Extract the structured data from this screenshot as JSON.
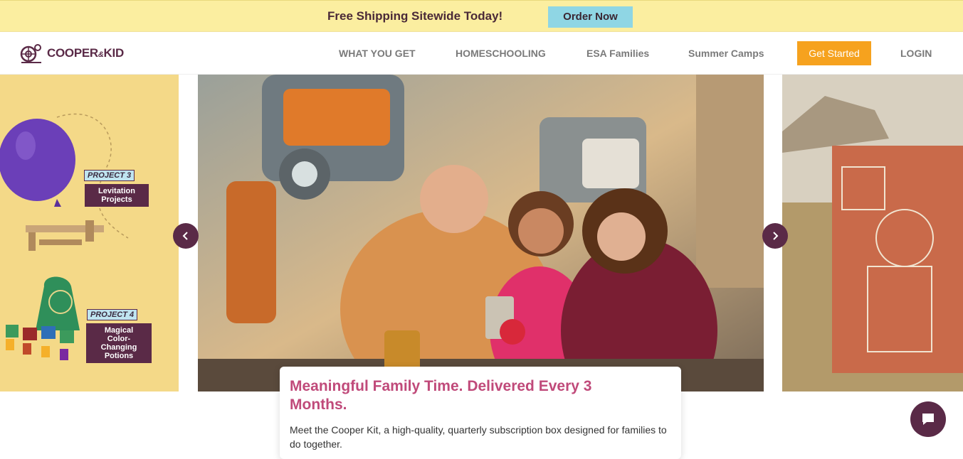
{
  "promo": {
    "text": "Free Shipping Sitewide Today!",
    "button": "Order Now"
  },
  "header": {
    "logo_text": "COOPER",
    "logo_amp": "&",
    "logo_text2": "KID",
    "nav": [
      {
        "label": "WHAT YOU GET"
      },
      {
        "label": "HOMESCHOOLING"
      },
      {
        "label": "ESA Families"
      },
      {
        "label": "Summer Camps"
      }
    ],
    "cta": "Get Started",
    "login": "LOGIN"
  },
  "slides": {
    "left": {
      "projects": [
        {
          "badge_word": "PROJECT",
          "badge_num": "3",
          "title_line1": "Levitation",
          "title_line2": "Projects"
        },
        {
          "badge_word": "PROJECT",
          "badge_num": "4",
          "title_line1": "Magical",
          "title_line2": "Color-Changing",
          "title_line3": "Potions"
        }
      ]
    }
  },
  "card": {
    "title": "Meaningful Family Time. Delivered Every 3 Months.",
    "body": "Meet the Cooper Kit, a high-quality, quarterly subscription box designed for families to do together."
  },
  "icons": [
    "chevron-left-icon",
    "chevron-right-icon",
    "chat-icon",
    "logo-icon"
  ],
  "colors": {
    "accent": "#f6a21e",
    "brand": "#5a2a47",
    "promo_bg": "#fbeea0",
    "title": "#c04a7a"
  }
}
